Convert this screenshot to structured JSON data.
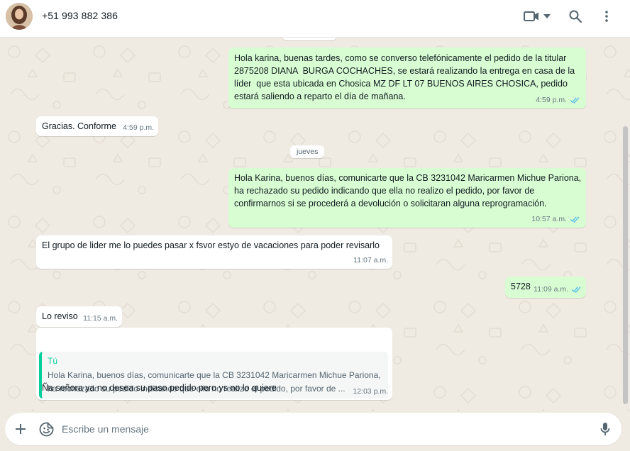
{
  "header": {
    "contact_name": "+51 993 882 386",
    "icons": [
      "video-call-icon",
      "chevron-down-icon",
      "search-icon",
      "more-options-icon"
    ]
  },
  "messages": [
    {
      "direction": "out",
      "text": "Hola karina, buenas tardes, como se converso telefónicamente el pedido de la titular 2875208 DIANA  BURGA COCHACHES, se estará realizando la entrega en casa de la líder  que esta ubicada en Chosica MZ DF LT 07 BUENOS AIRES CHOSICA, pedido estará saliendo a reparto el día de mañana.",
      "time": "4:59 p.m.",
      "status": "read"
    },
    {
      "direction": "in",
      "text": "Gracias. Conforme",
      "time": "4:59 p.m."
    },
    {
      "direction": "out",
      "text": "Hola Karina, buenos días, comunicarte que la CB 3231042 Maricarmen Michue Pariona, ha rechazado su pedido indicando que ella no realizo el pedido, por favor de confirmarnos si se procederá a devolución o solicitaran alguna reprogramación.",
      "time": "10:57 a.m.",
      "status": "read"
    },
    {
      "direction": "in",
      "text": "El grupo de lider me lo puedes pasar x fsvor estyo de vacaciones para poder revisarlo",
      "time": "11:07 a.m."
    },
    {
      "direction": "out",
      "text": "5728",
      "time": "11:09 a.m.",
      "status": "read"
    },
    {
      "direction": "in",
      "text": "Lo reviso",
      "time": "11:15 a.m."
    },
    {
      "direction": "in",
      "text": "Ña señora ya no desea su paso pedido pero ys no lo quiere",
      "time": "12:03 p.m.",
      "quoted": {
        "author": "Tú",
        "text": "Hola Karina, buenos días, comunicarte que la CB 3231042 Maricarmen Michue Pariona, ha rechazado su pedido indicando que ella no realizo el pedido, por favor de ..."
      }
    }
  ],
  "day_separator": "jueves",
  "composer": {
    "placeholder": "Escribe un mensaje",
    "icons": [
      "plus-icon",
      "emoji-sticker-icon",
      "microphone-icon"
    ]
  },
  "colors": {
    "outgoing_bubble": "#d9fdd3",
    "incoming_bubble": "#ffffff",
    "chat_background": "#efeae2",
    "read_ticks": "#53bdeb",
    "quote_accent": "#06cf9c"
  }
}
